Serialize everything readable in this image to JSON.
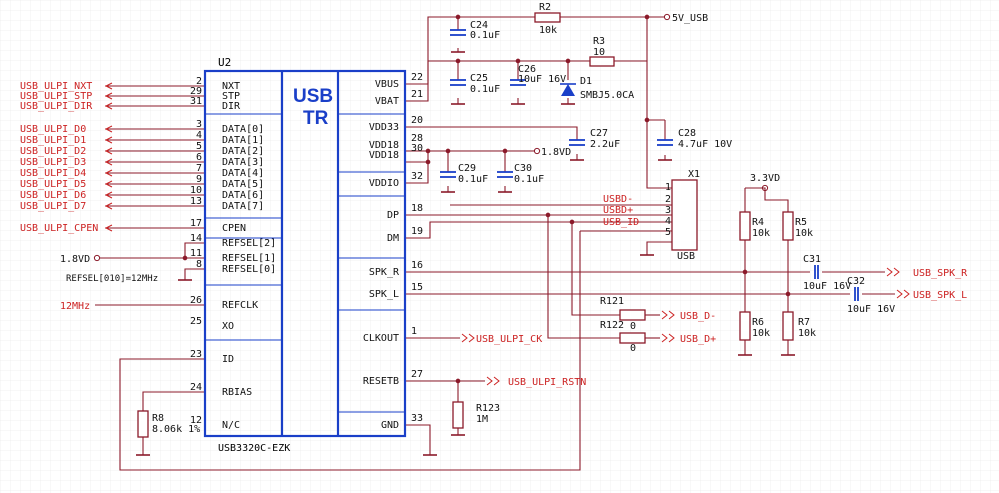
{
  "chip": {
    "ref": "U2",
    "part": "USB3320C-EZK",
    "title_line1": "USB",
    "title_line2": "TR",
    "left_pins": [
      {
        "num": "2",
        "name": "NXT"
      },
      {
        "num": "29",
        "name": "STP"
      },
      {
        "num": "31",
        "name": "DIR"
      },
      {
        "num": "3",
        "name": "DATA[0]"
      },
      {
        "num": "4",
        "name": "DATA[1]"
      },
      {
        "num": "5",
        "name": "DATA[2]"
      },
      {
        "num": "6",
        "name": "DATA[3]"
      },
      {
        "num": "7",
        "name": "DATA[4]"
      },
      {
        "num": "9",
        "name": "DATA[5]"
      },
      {
        "num": "10",
        "name": "DATA[6]"
      },
      {
        "num": "13",
        "name": "DATA[7]"
      },
      {
        "num": "17",
        "name": "CPEN"
      },
      {
        "num": "14",
        "name": "REFSEL[2]"
      },
      {
        "num": "11",
        "name": "REFSEL[1]"
      },
      {
        "num": "8",
        "name": "REFSEL[0]"
      },
      {
        "num": "26",
        "name": "REFCLK"
      },
      {
        "num": "25",
        "name": "XO"
      },
      {
        "num": "23",
        "name": "ID"
      },
      {
        "num": "24",
        "name": "RBIAS"
      },
      {
        "num": "12",
        "name": "N/C"
      }
    ],
    "right_pins": [
      {
        "num": "22",
        "name": "VBUS"
      },
      {
        "num": "21",
        "name": "VBAT"
      },
      {
        "num": "20",
        "name": "VDD33"
      },
      {
        "num": "28",
        "name": "VDD18"
      },
      {
        "num": "30",
        "name": "VDD18"
      },
      {
        "num": "32",
        "name": "VDDIO"
      },
      {
        "num": "18",
        "name": "DP"
      },
      {
        "num": "19",
        "name": "DM"
      },
      {
        "num": "16",
        "name": "SPK_R"
      },
      {
        "num": "15",
        "name": "SPK_L"
      },
      {
        "num": "1",
        "name": "CLKOUT"
      },
      {
        "num": "27",
        "name": "RESETB"
      },
      {
        "num": "33",
        "name": "GND"
      }
    ]
  },
  "left_nets": [
    "USB_ULPI_NXT",
    "USB_ULPI_STP",
    "USB_ULPI_DIR",
    "USB_ULPI_D0",
    "USB_ULPI_D1",
    "USB_ULPI_D2",
    "USB_ULPI_D3",
    "USB_ULPI_D4",
    "USB_ULPI_D5",
    "USB_ULPI_D6",
    "USB_ULPI_D7",
    "USB_ULPI_CPEN"
  ],
  "labels": {
    "v18_left": "1.8VD",
    "refsel_note": "REFSEL[010]=12MHz",
    "refclk_net": "12MHz",
    "v18_right": "1.8VD",
    "v5_usb": "5V_USB",
    "v33": "3.3VD",
    "clk_net": "USB_ULPI_CK",
    "rst_net": "USB_ULPI_RSTN",
    "usbd_minus": "USBD-",
    "usbd_plus": "USBD+",
    "usb_id": "USB_ID",
    "usb_d_minus": "USB_D-",
    "usb_d_plus": "USB_D+",
    "spk_r": "USB_SPK_R",
    "spk_l": "USB_SPK_L"
  },
  "components": {
    "R2": {
      "ref": "R2",
      "value": "10k"
    },
    "R3": {
      "ref": "R3",
      "value": "10"
    },
    "C24": {
      "ref": "C24",
      "value": "0.1uF"
    },
    "C25": {
      "ref": "C25",
      "value": "0.1uF"
    },
    "C26": {
      "ref": "C26",
      "value": "10uF 16V"
    },
    "D1": {
      "ref": "D1",
      "value": "SMBJ5.0CA"
    },
    "C27": {
      "ref": "C27",
      "value": "2.2uF"
    },
    "C28": {
      "ref": "C28",
      "value": "4.7uF 10V"
    },
    "C29": {
      "ref": "C29",
      "value": "0.1uF"
    },
    "C30": {
      "ref": "C30",
      "value": "0.1uF"
    },
    "X1": {
      "ref": "X1",
      "value": "USB",
      "pins": [
        "1",
        "2",
        "3",
        "4",
        "5"
      ]
    },
    "R4": {
      "ref": "R4",
      "value": "10k"
    },
    "R5": {
      "ref": "R5",
      "value": "10k"
    },
    "R6": {
      "ref": "R6",
      "value": "10k"
    },
    "R7": {
      "ref": "R7",
      "value": "10k"
    },
    "C31": {
      "ref": "C31",
      "value": "10uF 16V"
    },
    "C32": {
      "ref": "C32",
      "value": "10uF 16V"
    },
    "R121": {
      "ref": "R121",
      "value": "0"
    },
    "R122": {
      "ref": "R122",
      "value": "0"
    },
    "R123": {
      "ref": "R123",
      "value": "1M"
    },
    "R8": {
      "ref": "R8",
      "value": "8.06k 1%"
    }
  },
  "colors": {
    "wire": "#8b1a2a",
    "chip": "#1a3fc8",
    "net": "#cc2222",
    "grid": "#e6e6e6"
  }
}
